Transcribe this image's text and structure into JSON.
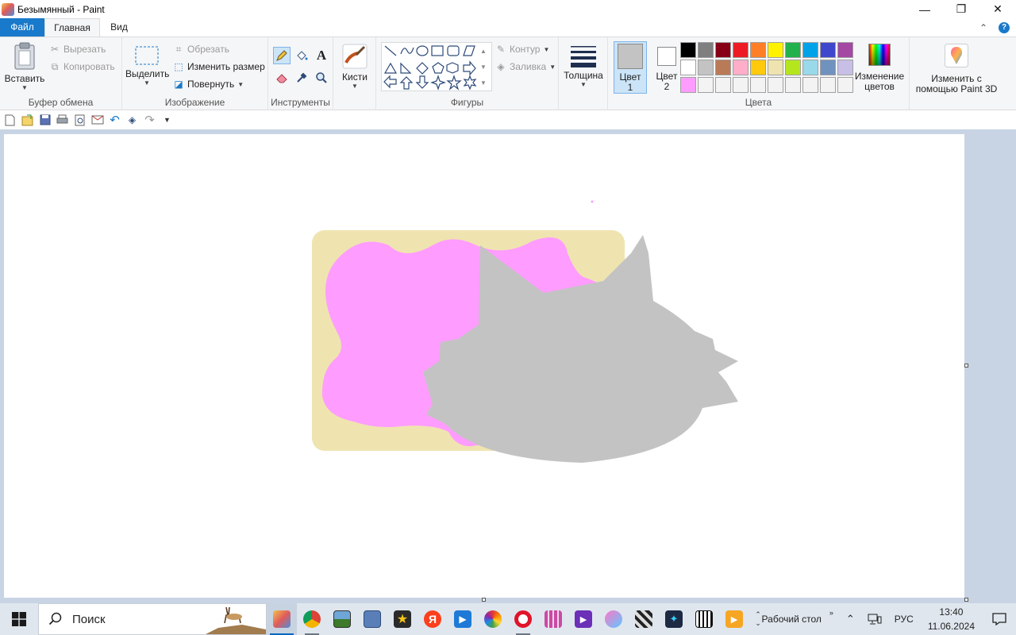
{
  "window": {
    "title": "Безымянный - Paint",
    "minimize_glyph": "—",
    "maximize_glyph": "❐",
    "close_glyph": "✕"
  },
  "tabs": {
    "file": "Файл",
    "home": "Главная",
    "view": "Вид",
    "collapse_glyph": "⌃",
    "help_glyph": "?"
  },
  "clipboard": {
    "paste": "Вставить",
    "cut": "Вырезать",
    "copy": "Копировать",
    "label": "Буфер обмена"
  },
  "image": {
    "select": "Выделить",
    "crop": "Обрезать",
    "resize": "Изменить размер",
    "rotate": "Повернуть",
    "label": "Изображение"
  },
  "tools": {
    "label": "Инструменты",
    "text_glyph": "A"
  },
  "brushes": {
    "label": "Кисти"
  },
  "shapes": {
    "outline": "Контур",
    "fill": "Заливка",
    "label": "Фигуры"
  },
  "size": {
    "label": "Толщина"
  },
  "colors": {
    "color1": "Цвет 1",
    "color2": "Цвет 2",
    "color1_value": "#c3c3c3",
    "color2_value": "#ffffff",
    "edit": "Изменение цветов",
    "label": "Цвета",
    "palette": [
      "#000000",
      "#7f7f7f",
      "#880015",
      "#ed1c24",
      "#ff7f27",
      "#fff200",
      "#22b14c",
      "#00a2e8",
      "#3f48cc",
      "#a349a4",
      "#ffffff",
      "#c3c3c3",
      "#b97a57",
      "#ffaec9",
      "#ffc90e",
      "#efe4b0",
      "#b5e61d",
      "#99d9ea",
      "#7092be",
      "#c8bfe7",
      "#ff9cff",
      "#f3f3f3",
      "#f3f3f3",
      "#f3f3f3",
      "#f3f3f3",
      "#f3f3f3",
      "#f3f3f3",
      "#f3f3f3",
      "#f3f3f3",
      "#f3f3f3"
    ]
  },
  "paint3d": {
    "label": "Изменить с помощью Paint 3D"
  },
  "drawing": {
    "rect_color": "#efe4b0",
    "blob_color": "#ff9cff",
    "cat_color": "#c3c3c3"
  },
  "taskbar": {
    "search": "Поиск",
    "desktop": "Рабочий стол",
    "lang": "РУС",
    "time": "13:40",
    "date": "11.06.2024"
  }
}
